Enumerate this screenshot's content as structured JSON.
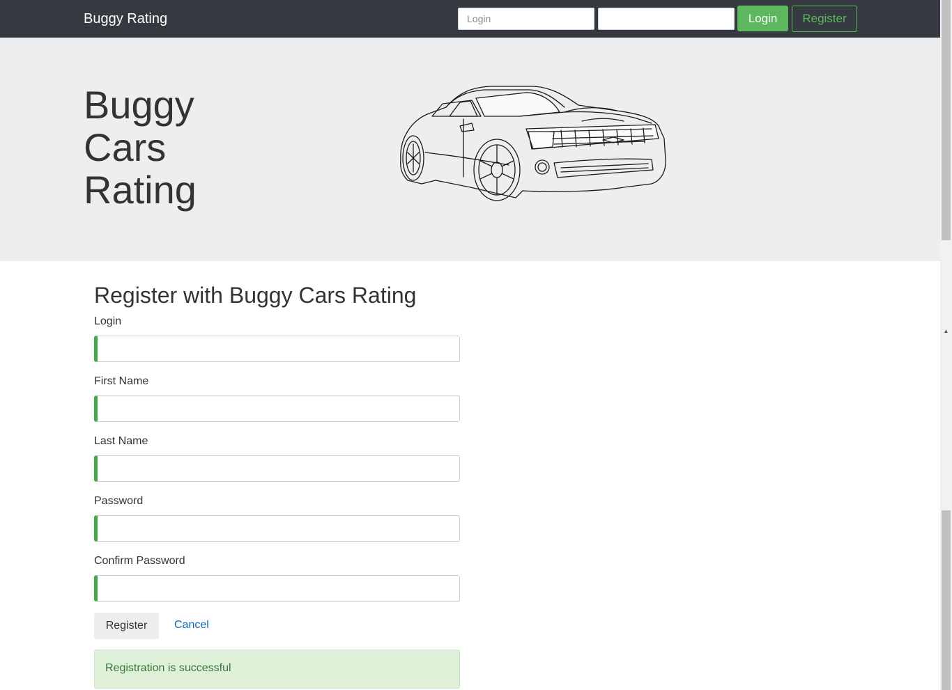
{
  "navbar": {
    "brand": "Buggy Rating",
    "login_placeholder": "Login",
    "password_placeholder": "",
    "login_button": "Login",
    "register_button": "Register"
  },
  "hero": {
    "title_line1": "Buggy",
    "title_line2": "Cars",
    "title_line3": "Rating",
    "image": "car-line-drawing"
  },
  "form": {
    "title": "Register with Buggy Cars Rating",
    "fields": [
      {
        "label": "Login",
        "value": ""
      },
      {
        "label": "First Name",
        "value": ""
      },
      {
        "label": "Last Name",
        "value": ""
      },
      {
        "label": "Password",
        "value": ""
      },
      {
        "label": "Confirm Password",
        "value": ""
      }
    ],
    "submit_label": "Register",
    "cancel_label": "Cancel",
    "success_message": "Registration is successful"
  },
  "colors": {
    "navbar_bg": "#343a40",
    "accent_green": "#5cb85c",
    "valid_border": "#42a948",
    "alert_bg": "#dff0d8",
    "alert_text": "#3c763d",
    "link": "#0b66c2"
  }
}
